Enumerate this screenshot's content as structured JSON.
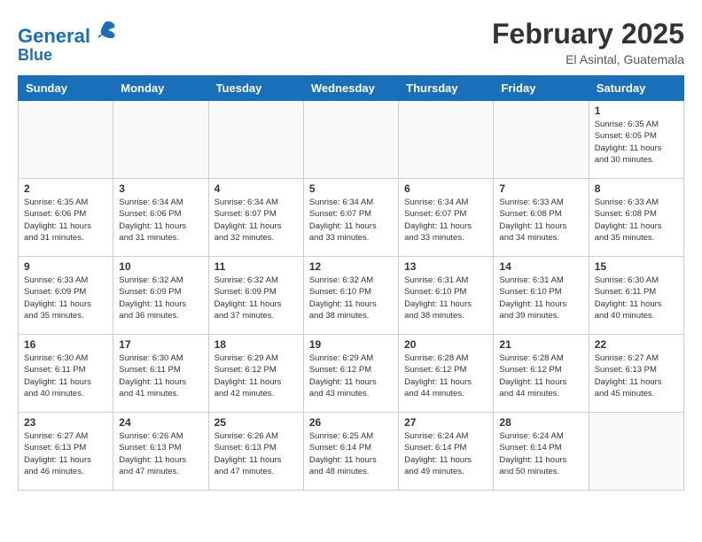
{
  "header": {
    "logo_line1": "General",
    "logo_line2": "Blue",
    "month_title": "February 2025",
    "location": "El Asintal, Guatemala"
  },
  "weekdays": [
    "Sunday",
    "Monday",
    "Tuesday",
    "Wednesday",
    "Thursday",
    "Friday",
    "Saturday"
  ],
  "weeks": [
    [
      {
        "day": "",
        "info": ""
      },
      {
        "day": "",
        "info": ""
      },
      {
        "day": "",
        "info": ""
      },
      {
        "day": "",
        "info": ""
      },
      {
        "day": "",
        "info": ""
      },
      {
        "day": "",
        "info": ""
      },
      {
        "day": "1",
        "info": "Sunrise: 6:35 AM\nSunset: 6:05 PM\nDaylight: 11 hours\nand 30 minutes."
      }
    ],
    [
      {
        "day": "2",
        "info": "Sunrise: 6:35 AM\nSunset: 6:06 PM\nDaylight: 11 hours\nand 31 minutes."
      },
      {
        "day": "3",
        "info": "Sunrise: 6:34 AM\nSunset: 6:06 PM\nDaylight: 11 hours\nand 31 minutes."
      },
      {
        "day": "4",
        "info": "Sunrise: 6:34 AM\nSunset: 6:07 PM\nDaylight: 11 hours\nand 32 minutes."
      },
      {
        "day": "5",
        "info": "Sunrise: 6:34 AM\nSunset: 6:07 PM\nDaylight: 11 hours\nand 33 minutes."
      },
      {
        "day": "6",
        "info": "Sunrise: 6:34 AM\nSunset: 6:07 PM\nDaylight: 11 hours\nand 33 minutes."
      },
      {
        "day": "7",
        "info": "Sunrise: 6:33 AM\nSunset: 6:08 PM\nDaylight: 11 hours\nand 34 minutes."
      },
      {
        "day": "8",
        "info": "Sunrise: 6:33 AM\nSunset: 6:08 PM\nDaylight: 11 hours\nand 35 minutes."
      }
    ],
    [
      {
        "day": "9",
        "info": "Sunrise: 6:33 AM\nSunset: 6:09 PM\nDaylight: 11 hours\nand 35 minutes."
      },
      {
        "day": "10",
        "info": "Sunrise: 6:32 AM\nSunset: 6:09 PM\nDaylight: 11 hours\nand 36 minutes."
      },
      {
        "day": "11",
        "info": "Sunrise: 6:32 AM\nSunset: 6:09 PM\nDaylight: 11 hours\nand 37 minutes."
      },
      {
        "day": "12",
        "info": "Sunrise: 6:32 AM\nSunset: 6:10 PM\nDaylight: 11 hours\nand 38 minutes."
      },
      {
        "day": "13",
        "info": "Sunrise: 6:31 AM\nSunset: 6:10 PM\nDaylight: 11 hours\nand 38 minutes."
      },
      {
        "day": "14",
        "info": "Sunrise: 6:31 AM\nSunset: 6:10 PM\nDaylight: 11 hours\nand 39 minutes."
      },
      {
        "day": "15",
        "info": "Sunrise: 6:30 AM\nSunset: 6:11 PM\nDaylight: 11 hours\nand 40 minutes."
      }
    ],
    [
      {
        "day": "16",
        "info": "Sunrise: 6:30 AM\nSunset: 6:11 PM\nDaylight: 11 hours\nand 40 minutes."
      },
      {
        "day": "17",
        "info": "Sunrise: 6:30 AM\nSunset: 6:11 PM\nDaylight: 11 hours\nand 41 minutes."
      },
      {
        "day": "18",
        "info": "Sunrise: 6:29 AM\nSunset: 6:12 PM\nDaylight: 11 hours\nand 42 minutes."
      },
      {
        "day": "19",
        "info": "Sunrise: 6:29 AM\nSunset: 6:12 PM\nDaylight: 11 hours\nand 43 minutes."
      },
      {
        "day": "20",
        "info": "Sunrise: 6:28 AM\nSunset: 6:12 PM\nDaylight: 11 hours\nand 44 minutes."
      },
      {
        "day": "21",
        "info": "Sunrise: 6:28 AM\nSunset: 6:12 PM\nDaylight: 11 hours\nand 44 minutes."
      },
      {
        "day": "22",
        "info": "Sunrise: 6:27 AM\nSunset: 6:13 PM\nDaylight: 11 hours\nand 45 minutes."
      }
    ],
    [
      {
        "day": "23",
        "info": "Sunrise: 6:27 AM\nSunset: 6:13 PM\nDaylight: 11 hours\nand 46 minutes."
      },
      {
        "day": "24",
        "info": "Sunrise: 6:26 AM\nSunset: 6:13 PM\nDaylight: 11 hours\nand 47 minutes."
      },
      {
        "day": "25",
        "info": "Sunrise: 6:26 AM\nSunset: 6:13 PM\nDaylight: 11 hours\nand 47 minutes."
      },
      {
        "day": "26",
        "info": "Sunrise: 6:25 AM\nSunset: 6:14 PM\nDaylight: 11 hours\nand 48 minutes."
      },
      {
        "day": "27",
        "info": "Sunrise: 6:24 AM\nSunset: 6:14 PM\nDaylight: 11 hours\nand 49 minutes."
      },
      {
        "day": "28",
        "info": "Sunrise: 6:24 AM\nSunset: 6:14 PM\nDaylight: 11 hours\nand 50 minutes."
      },
      {
        "day": "",
        "info": ""
      }
    ]
  ]
}
